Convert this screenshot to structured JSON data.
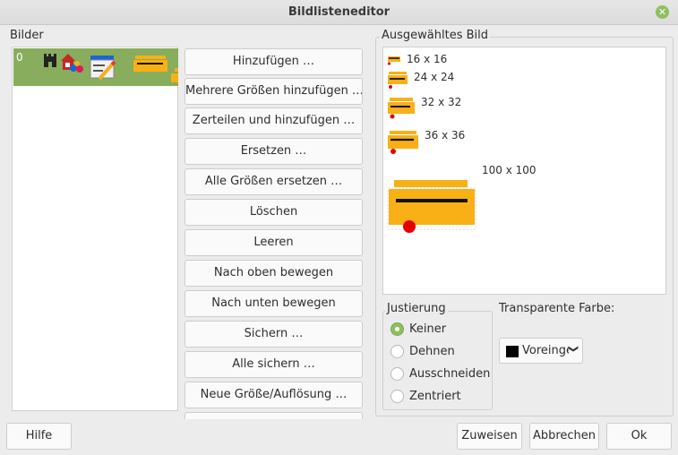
{
  "window": {
    "title": "Bildlisteneditor"
  },
  "images_panel": {
    "label": "Bilder",
    "items": [
      {
        "index": "0"
      }
    ]
  },
  "actions": {
    "add": "Hinzufügen …",
    "add_multi": "Mehrere Größen hinzufügen …",
    "split_add": "Zerteilen und hinzufügen …",
    "replace": "Ersetzen …",
    "replace_all": "Alle Größen ersetzen …",
    "delete": "Löschen",
    "clear": "Leeren",
    "move_up": "Nach oben bewegen",
    "move_down": "Nach unten bewegen",
    "save": "Sichern …",
    "save_all": "Alle sichern …",
    "new_size": "Neue Größe/Auflösung …"
  },
  "selected_panel": {
    "label": "Ausgewähltes Bild",
    "sizes": [
      "16 x 16",
      "24 x 24",
      "32 x 32",
      "36 x 36",
      "100 x 100"
    ]
  },
  "justification": {
    "label": "Justierung",
    "selected": "Keiner",
    "options": [
      "Keiner",
      "Dehnen",
      "Ausschneiden",
      "Zentriert"
    ]
  },
  "transparent_color": {
    "label": "Transparente Farbe:",
    "value": "Voreingestellt"
  },
  "footer": {
    "help": "Hilfe",
    "assign": "Zuweisen",
    "cancel": "Abbrechen",
    "ok": "Ok"
  },
  "colors": {
    "accent": "#8fbf5e",
    "list_selection": "#88ad5c",
    "bench_orange": "#f9b016",
    "marker_red": "#e60000"
  }
}
